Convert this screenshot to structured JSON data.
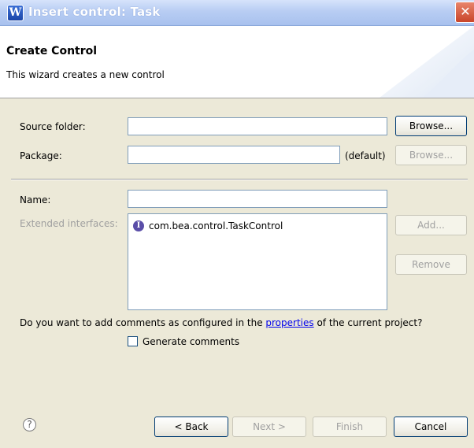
{
  "window": {
    "title": "Insert control: Task",
    "app_icon": "eclipse-w-icon",
    "close_label": "✕"
  },
  "header": {
    "title": "Create Control",
    "description": "This wizard creates a new control"
  },
  "form": {
    "source_folder_label": "Source folder:",
    "source_folder_value": "",
    "package_label": "Package:",
    "package_value": "",
    "package_default_hint": "(default)",
    "browse_label": "Browse...",
    "name_label": "Name:",
    "name_value": "",
    "extended_interfaces_label": "Extended interfaces:",
    "interfaces": [
      {
        "icon": "interface-icon",
        "icon_glyph": "I",
        "name": "com.bea.control.TaskControl"
      }
    ],
    "add_label": "Add...",
    "remove_label": "Remove"
  },
  "comments": {
    "question_before": "Do you want to add comments as configured in the ",
    "link_text": "properties",
    "question_after": " of the current project?",
    "checkbox_label": "Generate comments",
    "checked": false
  },
  "footer": {
    "help_glyph": "?",
    "back_label": "< Back",
    "next_label": "Next >",
    "finish_label": "Finish",
    "cancel_label": "Cancel"
  },
  "colors": {
    "title_bar": "#b8cdf3",
    "dialog_bg": "#ece9d8",
    "link": "#0000ee"
  }
}
